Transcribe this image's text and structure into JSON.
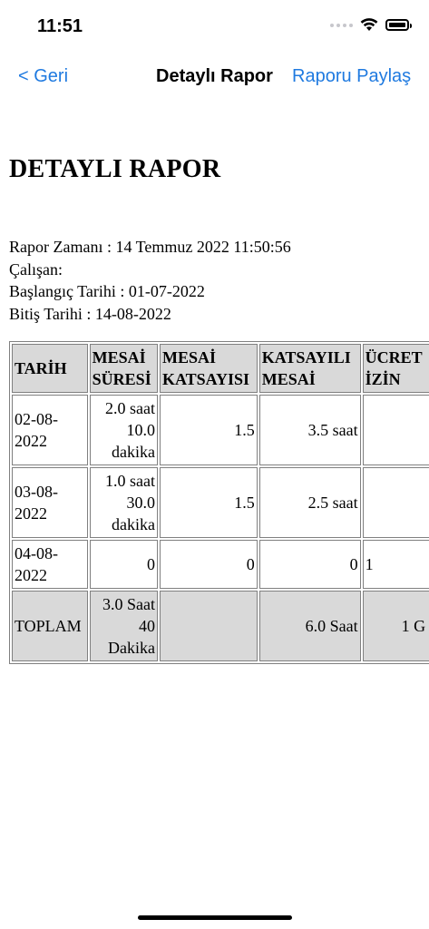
{
  "status_bar": {
    "time": "11:51"
  },
  "nav": {
    "back_label": "< Geri",
    "title": "Detaylı Rapor",
    "share_label": "Raporu Paylaş"
  },
  "report": {
    "heading": "DETAYLI RAPOR",
    "meta": {
      "report_time": "Rapor Zamanı : 14 Temmuz 2022 11:50:56",
      "employee": "Çalışan:",
      "start_date": "Başlangıç Tarihi : 01-07-2022",
      "end_date": "Bitiş Tarihi : 14-08-2022"
    },
    "table": {
      "headers": [
        "TARİH",
        "MESAİ SÜRESİ",
        "MESAİ KATSAYISI",
        "KATSAYILI MESAİ",
        "ÜCRET... İZİN"
      ],
      "header_lines": [
        [
          "TARİH"
        ],
        [
          "MESAİ",
          "SÜRESİ"
        ],
        [
          "MESAİ",
          "KATSAYISI"
        ],
        [
          "KATSAYILI",
          "MESAİ"
        ],
        [
          "ÜCRET",
          "İZİN"
        ]
      ],
      "rows": [
        {
          "date": "02-08-2022",
          "date_lines": [
            "02-08-",
            "2022"
          ],
          "duration_lines": [
            "2.0 saat",
            "10.0",
            "dakika"
          ],
          "coefficient": "1.5",
          "weighted": "3.5 saat",
          "leave": ""
        },
        {
          "date": "03-08-2022",
          "date_lines": [
            "03-08-",
            "2022"
          ],
          "duration_lines": [
            "1.0 saat",
            "30.0",
            "dakika"
          ],
          "coefficient": "1.5",
          "weighted": "2.5 saat",
          "leave": ""
        },
        {
          "date": "04-08-2022",
          "date_lines": [
            "04-08-",
            "2022"
          ],
          "duration_lines": [
            "0"
          ],
          "coefficient": "0",
          "weighted": "0",
          "leave": "1"
        }
      ],
      "total": {
        "label": "TOPLAM",
        "duration_lines": [
          "3.0 Saat",
          "40",
          "Dakika"
        ],
        "coefficient": "",
        "weighted": "6.0 Saat",
        "leave": "1 G"
      }
    }
  }
}
